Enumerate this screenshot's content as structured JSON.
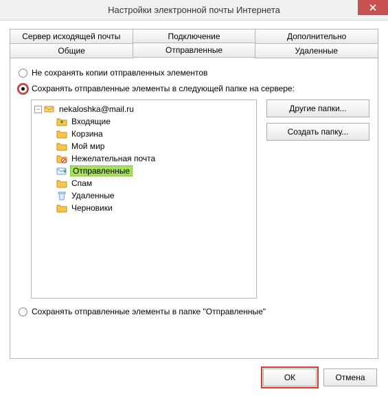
{
  "window": {
    "title": "Настройки электронной почты Интернета"
  },
  "tabs": {
    "row1": [
      {
        "label": "Сервер исходящей почты"
      },
      {
        "label": "Подключение"
      },
      {
        "label": "Дополнительно"
      }
    ],
    "row2": [
      {
        "label": "Общие"
      },
      {
        "label": "Отправленные",
        "active": true
      },
      {
        "label": "Удаленные"
      }
    ]
  },
  "options": {
    "no_save": "Не сохранять копии отправленных элементов",
    "save_in_folder": "Сохранять отправленные элементы в следующей папке на сервере:",
    "save_in_sent": "Сохранять отправленные элементы в папке \"Отправленные\""
  },
  "side_buttons": {
    "other_folders": "Другие папки...",
    "create_folder": "Создать папку..."
  },
  "tree": {
    "root_label": "nekaloshka@mail.ru",
    "children": [
      {
        "label": "Входящие",
        "icon": "inbox"
      },
      {
        "label": "Корзина",
        "icon": "folder"
      },
      {
        "label": "Мой мир",
        "icon": "folder"
      },
      {
        "label": "Нежелательная почта",
        "icon": "junk"
      },
      {
        "label": "Отправленные",
        "icon": "sent",
        "selected": true
      },
      {
        "label": "Спам",
        "icon": "folder"
      },
      {
        "label": "Удаленные",
        "icon": "deleted"
      },
      {
        "label": "Черновики",
        "icon": "folder"
      }
    ]
  },
  "footer": {
    "ok": "ОК",
    "cancel": "Отмена"
  }
}
